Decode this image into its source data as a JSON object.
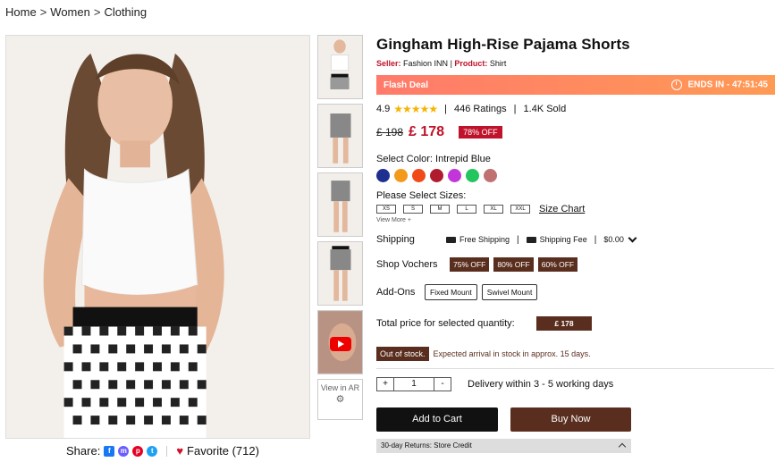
{
  "breadcrumb": [
    "Home",
    "Women",
    "Clothing"
  ],
  "breadcrumb_sep": ">",
  "product": {
    "title": "Gingham High-Rise Pajama Shorts",
    "seller_label": "Seller:",
    "seller": "Fashion INN",
    "product_label": "Product:",
    "product_type": "Shirt"
  },
  "flash": {
    "label": "Flash Deal",
    "ends_label": "ENDS IN -",
    "countdown": "47:51:45"
  },
  "rating": {
    "score": "4.9",
    "stars": "★★★★★",
    "ratings": "446 Ratings",
    "sold": "1.4K Sold"
  },
  "price": {
    "old": "£ 198",
    "new": "£ 178",
    "off": "78% OFF"
  },
  "color": {
    "label": "Select Color:",
    "selected": "Intrepid Blue",
    "swatches": [
      "#1f2f8f",
      "#f39a1d",
      "#f04a1a",
      "#b01c2e",
      "#c236d9",
      "#22c55e",
      "#c07070"
    ]
  },
  "sizes": {
    "label": "Please Select Sizes:",
    "options": [
      "XS",
      "S",
      "M",
      "L",
      "XL",
      "XXL"
    ],
    "chart": "Size Chart",
    "view_more": "View More +"
  },
  "shipping": {
    "label": "Shipping",
    "free": "Free Shipping",
    "fee_label": "Shipping Fee",
    "fee": "$0.00"
  },
  "vouchers": {
    "label": "Shop Vochers",
    "items": [
      "75% OFF",
      "80% OFF",
      "60% OFF"
    ]
  },
  "addons": {
    "label": "Add-Ons",
    "items": [
      "Fixed Mount",
      "Swivel Mount"
    ]
  },
  "total": {
    "label": "Total price for selected quantity:",
    "value": "£ 178"
  },
  "stock": {
    "badge": "Out of stock.",
    "arrival": "Expected arrival in stock in approx. 15 days."
  },
  "quantity": {
    "minus": "-",
    "plus": "+",
    "value": "1"
  },
  "delivery": "Delivery within 3 - 5 working days",
  "buttons": {
    "cart": "Add to Cart",
    "buy": "Buy Now"
  },
  "returns": "30-day Returns: Store Credit",
  "share": {
    "label": "Share:",
    "favorite": "Favorite (712)"
  },
  "ar": "View in AR",
  "colors": {
    "accent": "#c0122a",
    "brown": "#5a2e1e"
  }
}
